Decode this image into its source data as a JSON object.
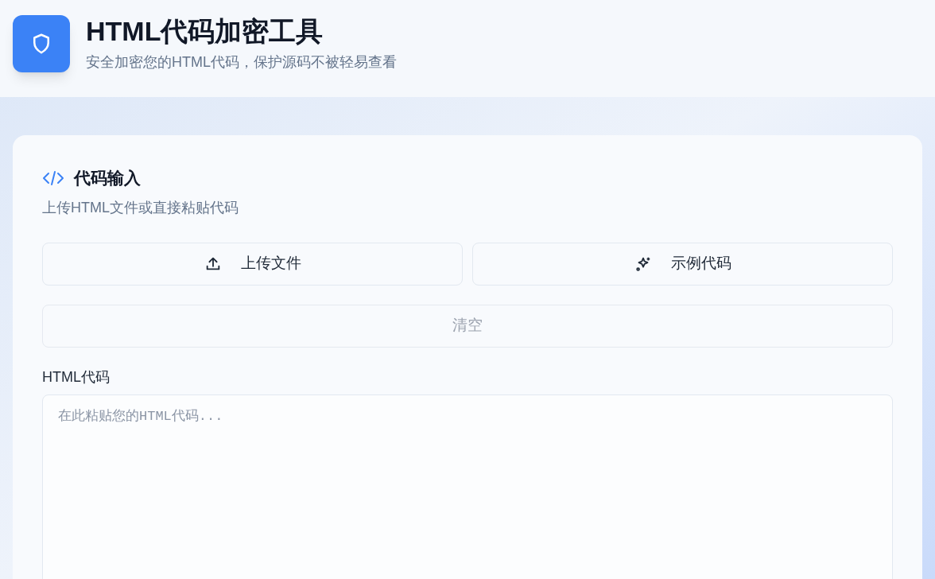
{
  "header": {
    "title": "HTML代码加密工具",
    "subtitle": "安全加密您的HTML代码，保护源码不被轻易查看"
  },
  "card": {
    "title": "代码输入",
    "description": "上传HTML文件或直接粘贴代码",
    "actions": [
      {
        "kind": "upload",
        "label": "上传文件"
      },
      {
        "kind": "sample",
        "label": "示例代码"
      }
    ],
    "clear": {
      "label": "清空",
      "disabled": true
    },
    "field": {
      "label": "HTML代码",
      "placeholder": "在此粘贴您的HTML代码..."
    }
  }
}
